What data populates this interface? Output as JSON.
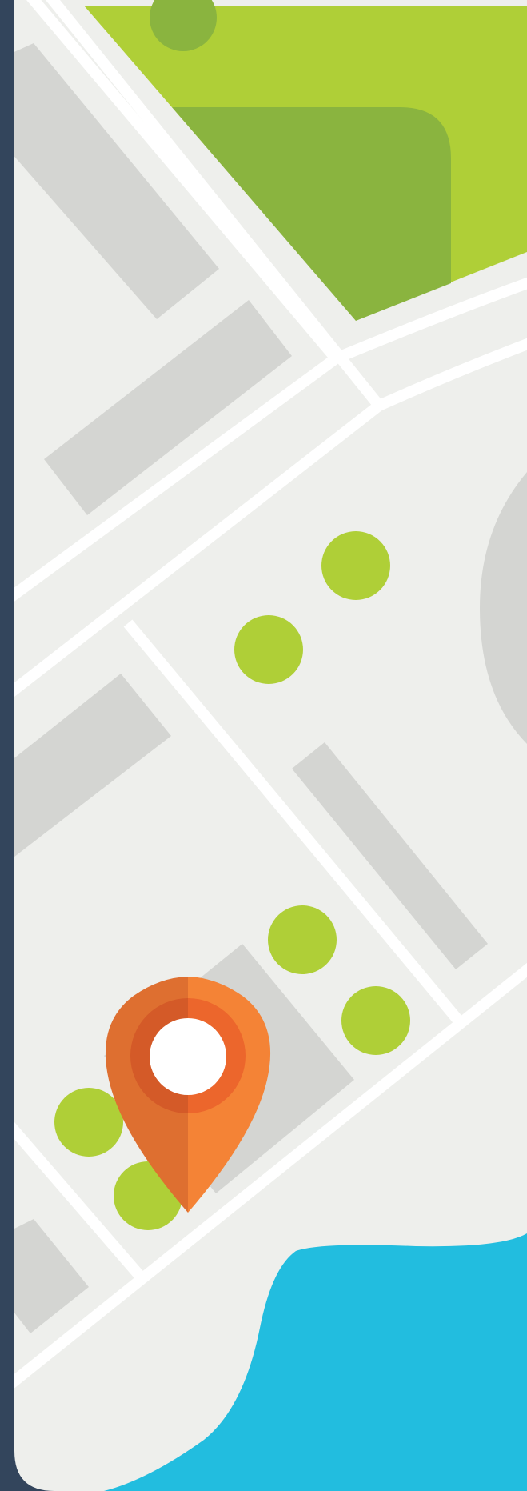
{
  "map": {
    "marker": {
      "icon": "location-pin-icon"
    },
    "colors": {
      "frame": "#33455c",
      "land": "#eeefec",
      "road": "#ffffff",
      "building": "#d4d5d2",
      "park": "#afcf37",
      "park_dark": "#8ab43f",
      "tree": "#afcf37",
      "water": "#22bddf",
      "marker_left": "#de6f30",
      "marker_right": "#f48336",
      "marker_ring_left": "#d45a28",
      "marker_ring_right": "#ec662c",
      "marker_center": "#ffffff"
    }
  }
}
